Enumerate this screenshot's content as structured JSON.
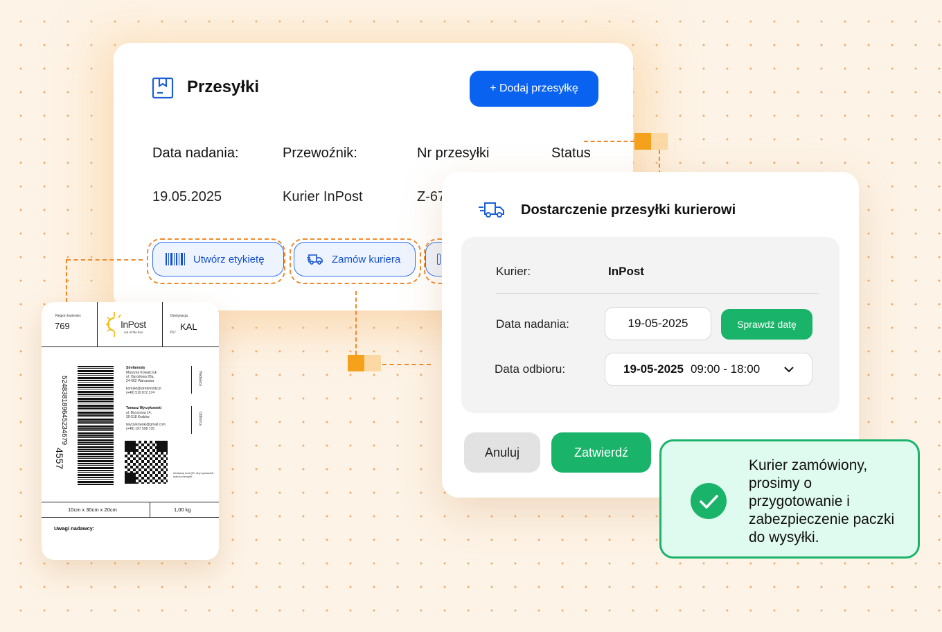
{
  "shipments": {
    "title": "Przesyłki",
    "add_button": "+ Dodaj przesyłkę",
    "columns": [
      "Data nadania:",
      "Przewoźnik:",
      "Nr przesyłki",
      "Status"
    ],
    "row": {
      "date": "19.05.2025",
      "carrier": "Kurier InPost",
      "number": "Z-67"
    },
    "actions": {
      "create_label": "Utwórz etykietę",
      "order_courier": "Zamów kuriera"
    }
  },
  "courier": {
    "title": "Dostarczenie przesyłki kurierowi",
    "courier_label": "Kurier:",
    "courier_value": "InPost",
    "send_date_label": "Data nadania:",
    "send_date_value": "19-05-2025",
    "check_date_button": "Sprawdź datę",
    "pickup_label": "Data odbioru:",
    "pickup_date": "19-05-2025",
    "pickup_time": "09:00 - 18:00",
    "cancel_button": "Anuluj",
    "confirm_button": "Zatwierdź"
  },
  "toast": {
    "message": "Kurier zamówiony, prosimy o przygotowanie i zabezpieczenie paczki do wysyłki."
  },
  "label": {
    "region_label": "Region kurierski:",
    "region_value": "769",
    "logo_text": "InPost",
    "logo_tagline": "out of the box",
    "destination_label": "Destynacja:",
    "destination_prefix": "PL/",
    "destination_value": "KAL",
    "barcode_number": "524838189645234679",
    "code": "4557",
    "sender_name": "Strefamody",
    "sender_lines": [
      "Marzyna Kowalczyk",
      "ul. Ogrodowa 28a,",
      "24-662 Warszawa",
      "kontakt@strefymody.pl",
      "(+48) 510 872 374"
    ],
    "recipient_name": "Tomasz Wyrzykowski",
    "recipient_lines": [
      "ul. Brzozowa 14,",
      "30-518 Kraków",
      "twyrzykowski@gmail.com",
      "(+48) 197 598 735"
    ],
    "side_sender": "Nadawca",
    "side_recipient": "Odbiorca",
    "qr_note": "Zeskanuj kod QR, aby sprawdzić status przesyłki",
    "dimensions": "10cm x 30cm x 20cm",
    "weight": "1,00 kg",
    "notes_label": "Uwagi nadawcy:"
  },
  "colors": {
    "primary": "#0a63f0",
    "success": "#19b46a",
    "accent_orange": "#f08a2c",
    "toast_bg": "#dffaee"
  }
}
